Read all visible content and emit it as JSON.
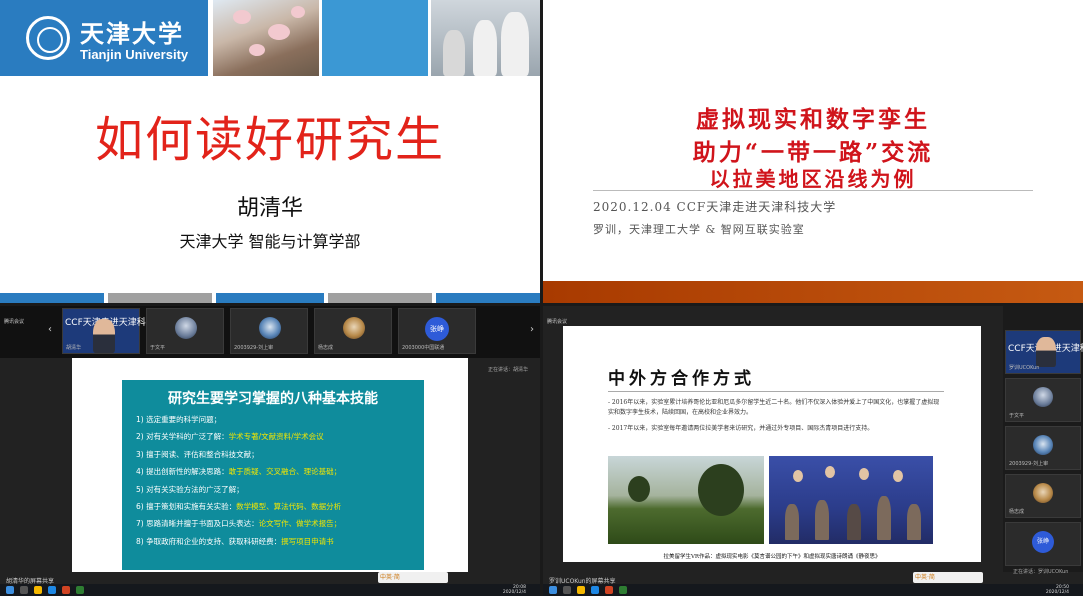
{
  "q1": {
    "logo_cn": "天津大学",
    "logo_en": "Tianjin University",
    "title": "如何读好研究生",
    "speaker": "胡清华",
    "affiliation": "天津大学 智能与计算学部",
    "stripe_colors": [
      "#2a7cc0",
      "#a0a0a0",
      "#2a7cc0",
      "#a0a0a0",
      "#2a7cc0"
    ]
  },
  "q2": {
    "title_line1": "虚拟现实和数字孪生",
    "title_line2": "助力“一带一路”交流",
    "title_line3": "以拉美地区沿线为例",
    "date_line": "2020.12.04 CCF天津走进天津科技大学",
    "author_line": "罗训，天津理工大学 & 智网互联实验室",
    "accent_color": "#d0141b"
  },
  "q3": {
    "meeting_label": "腾讯会议",
    "participants": [
      {
        "name": "胡清华",
        "banner": "CCF天津走进天津科技高校"
      },
      {
        "name": "于文平"
      },
      {
        "name": "2003929-刘上审"
      },
      {
        "name": "杨志成"
      },
      {
        "name": "2003000中国联通",
        "initials": "张峥"
      }
    ],
    "talking": "正在讲话：胡清华",
    "slide": {
      "title": "研究生要学习掌握的八种基本技能",
      "items": [
        {
          "n": "1)",
          "text": "选定重要的科学问题；",
          "hl": ""
        },
        {
          "n": "2)",
          "text": "对有关学科的广泛了解：",
          "hl": "学术专著/文献资料/学术会议"
        },
        {
          "n": "3)",
          "text": "擅于阅读、评估和整合科技文献；",
          "hl": ""
        },
        {
          "n": "4)",
          "text": "提出创新性的解决思路：",
          "hl": "敢于质疑、交叉融合、理论基础；"
        },
        {
          "n": "5)",
          "text": "对有关实验方法的广泛了解；",
          "hl": ""
        },
        {
          "n": "6)",
          "text": "擅于策划和实施有关实验：",
          "hl": "数学模型、算法代码、数据分析"
        },
        {
          "n": "7)",
          "text": "思路清晰并擅于书面及口头表达：",
          "hl": "论文写作、做学术报告；"
        },
        {
          "n": "8)",
          "text": "争取政府和企业的支持、获取科研经费：",
          "hl": "撰写项目申请书"
        }
      ]
    },
    "share_label": "胡清华的屏幕共享",
    "ime_label": "中英·简",
    "clock_time": "20:08",
    "clock_date": "2020/12/4"
  },
  "q4": {
    "meeting_label": "腾讯会议",
    "slide": {
      "heading": "中外方合作方式",
      "para1": "- 2016年以来，实验室累计培养哥伦比亚和厄瓜多尔留学生近二十名。他们不仅深入体验并爱上了中国文化，也掌握了虚拟现实和数字孪生技术，陆续回国，在高校和企业界效力。",
      "para2": "- 2017年以来，实验室每年邀请两位拉美学者来访研究，并通过外专项目、国际杰青项目进行支持。",
      "caption": "拉美留学生VR作品：虚拟现实电影《莫言谱公园的下午》和虚拟现实唐诗朗诵《静夜思》"
    },
    "side": [
      {
        "name": "罗训UCOKun",
        "banner": "CCF天津走进天津科技高校"
      },
      {
        "name": "于文平"
      },
      {
        "name": "2003929-刘上审"
      },
      {
        "name": "杨志成"
      },
      {
        "name": "",
        "initials": "张峥"
      }
    ],
    "talking": "正在讲话：罗训UCOKun",
    "share_label": "罗训UCOKun的屏幕共享",
    "ime_label": "中英·简",
    "clock_time": "20:50",
    "clock_date": "2020/12/4"
  }
}
